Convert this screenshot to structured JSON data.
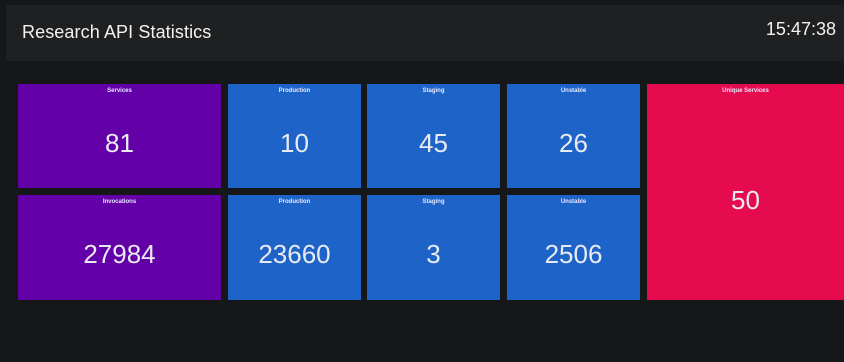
{
  "header": {
    "title": "Research API Statistics",
    "clock": "15:47:38"
  },
  "tiles": {
    "services": {
      "label": "Services",
      "value": "81"
    },
    "services_production": {
      "label": "Production",
      "value": "10"
    },
    "services_staging": {
      "label": "Staging",
      "value": "45"
    },
    "services_unstable": {
      "label": "Unstable",
      "value": "26"
    },
    "unique_services": {
      "label": "Unique Services",
      "value": "50"
    },
    "invocations": {
      "label": "Invocations",
      "value": "27984"
    },
    "invocations_production": {
      "label": "Production",
      "value": "23660"
    },
    "invocations_staging": {
      "label": "Staging",
      "value": "3"
    },
    "invocations_unstable": {
      "label": "Unstable",
      "value": "2506"
    }
  },
  "colors": {
    "background": "#161718",
    "header": "#1f2021",
    "purple": "#6400a8",
    "blue": "#1e63c7",
    "red": "#e60a4e"
  }
}
